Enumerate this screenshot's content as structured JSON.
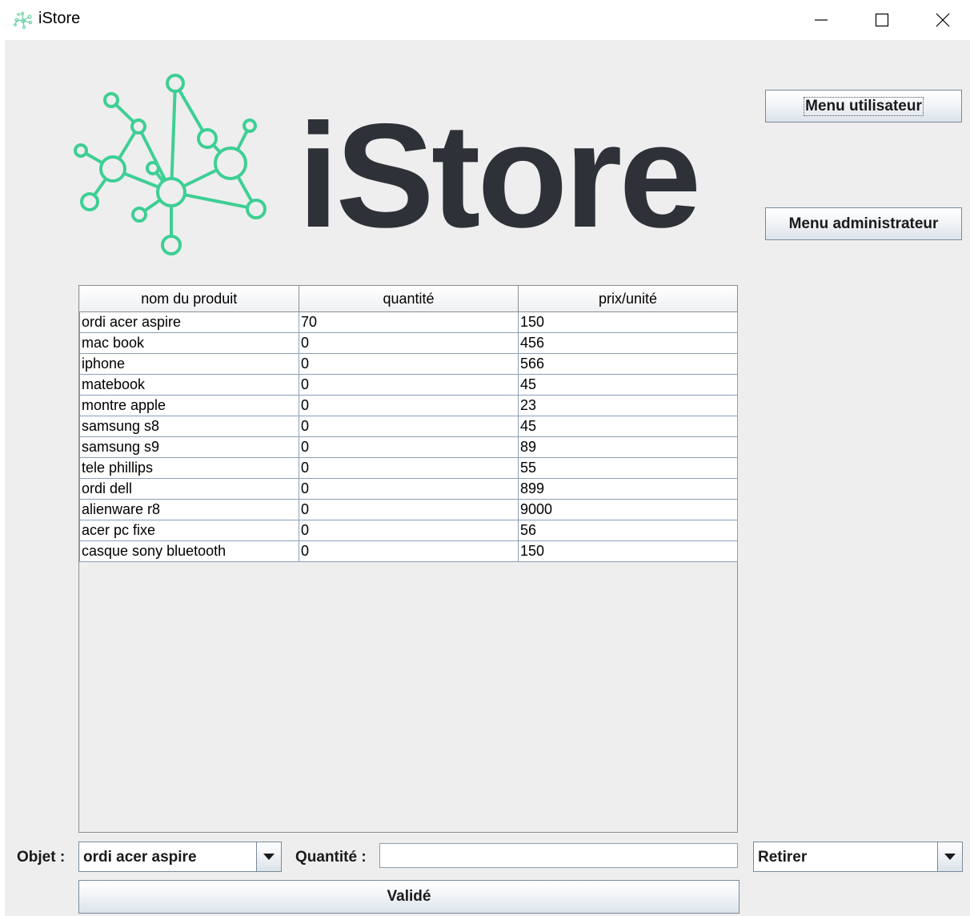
{
  "window": {
    "title": "iStore",
    "app_icon": "molecule-logo-icon",
    "controls": [
      "minimize-icon",
      "maximize-icon",
      "close-icon"
    ]
  },
  "logo": {
    "text": "iStore",
    "icon": "molecule-network-icon",
    "accent_color": "#3ecf94",
    "text_color": "#2e3138"
  },
  "buttons": {
    "user_menu": "Menu utilisateur",
    "admin_menu": "Menu administrateur",
    "validate": "Validé"
  },
  "table": {
    "headers": [
      "nom du produit",
      "quantité",
      "prix/unité"
    ],
    "rows": [
      [
        "ordi acer aspire",
        "70",
        "150"
      ],
      [
        "mac book",
        "0",
        "456"
      ],
      [
        "iphone",
        "0",
        "566"
      ],
      [
        "matebook",
        "0",
        "45"
      ],
      [
        "montre apple",
        "0",
        "23"
      ],
      [
        "samsung s8",
        "0",
        "45"
      ],
      [
        "samsung s9",
        "0",
        "89"
      ],
      [
        "tele phillips",
        "0",
        "55"
      ],
      [
        "ordi dell",
        "0",
        "899"
      ],
      [
        "alienware r8",
        "0",
        "9000"
      ],
      [
        "acer pc fixe",
        "0",
        "56"
      ],
      [
        "casque sony bluetooth",
        "0",
        "150"
      ]
    ]
  },
  "form": {
    "object_label": "Objet :",
    "object_selected": "ordi acer aspire",
    "quantity_label": "Quantité :",
    "quantity_value": "",
    "action_selected": "Retirer"
  }
}
